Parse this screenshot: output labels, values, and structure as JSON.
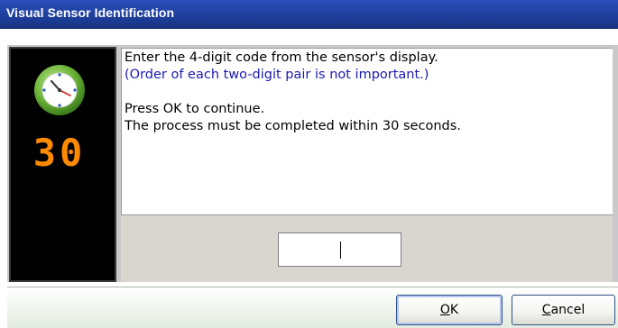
{
  "window": {
    "title": "Visual Sensor Identification"
  },
  "timer": {
    "value": "30",
    "icon": "clock-icon",
    "digit_color": "#ff8a00"
  },
  "message": {
    "line1": "Enter the 4-digit code from the sensor's display.",
    "line2": "(Order of each two-digit pair is not important.)",
    "line3": "Press OK to continue.",
    "line4": "The process must be completed within 30 seconds."
  },
  "code_input": {
    "first_pair": "",
    "second_pair": ""
  },
  "buttons": {
    "ok": {
      "label_mnemonic": "O",
      "label_rest": "K"
    },
    "cancel": {
      "label_mnemonic": "C",
      "label_rest": "ancel"
    }
  },
  "colors": {
    "title_bar": "#1e3f9c",
    "note_text": "#1a1ab4"
  }
}
